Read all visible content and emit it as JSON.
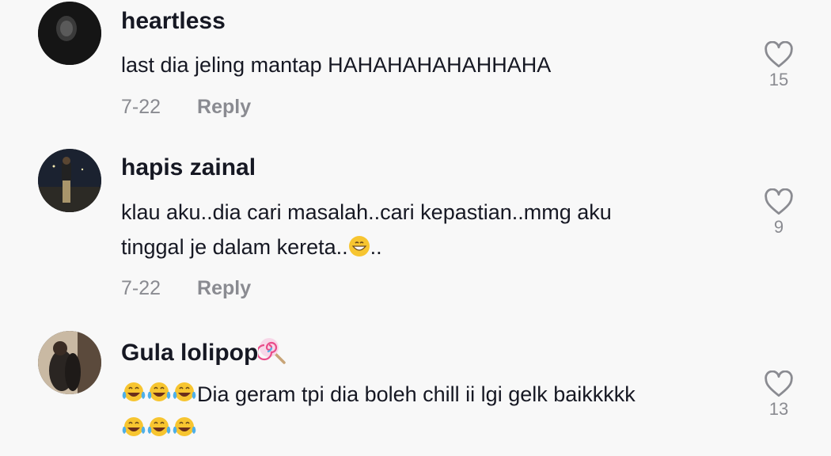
{
  "comments": [
    {
      "username": "heartless",
      "text": "last dia jeling mantap HAHAHAHAHAHHAHA",
      "date": "7-22",
      "reply": "Reply",
      "likes": "15"
    },
    {
      "username": "hapis zainal",
      "text_line1": "klau aku..dia cari masalah..cari kepastian..mmg aku",
      "text_line2_a": "tinggal je dalam kereta..",
      "text_line2_b": "..",
      "date": "7-22",
      "reply": "Reply",
      "likes": "9"
    },
    {
      "username": "Gula lolipop",
      "text_line1": "Dia geram tpi dia boleh chill ii lgi gelk baikkkkk",
      "likes": "13"
    }
  ],
  "colors": {
    "text": "#161823",
    "muted": "#8a8b91",
    "background": "#f8f8f8"
  },
  "icons": [
    "heart-outline-icon",
    "grinning-emoji-icon",
    "tears-of-joy-emoji-icon",
    "lollipop-emoji-icon"
  ]
}
